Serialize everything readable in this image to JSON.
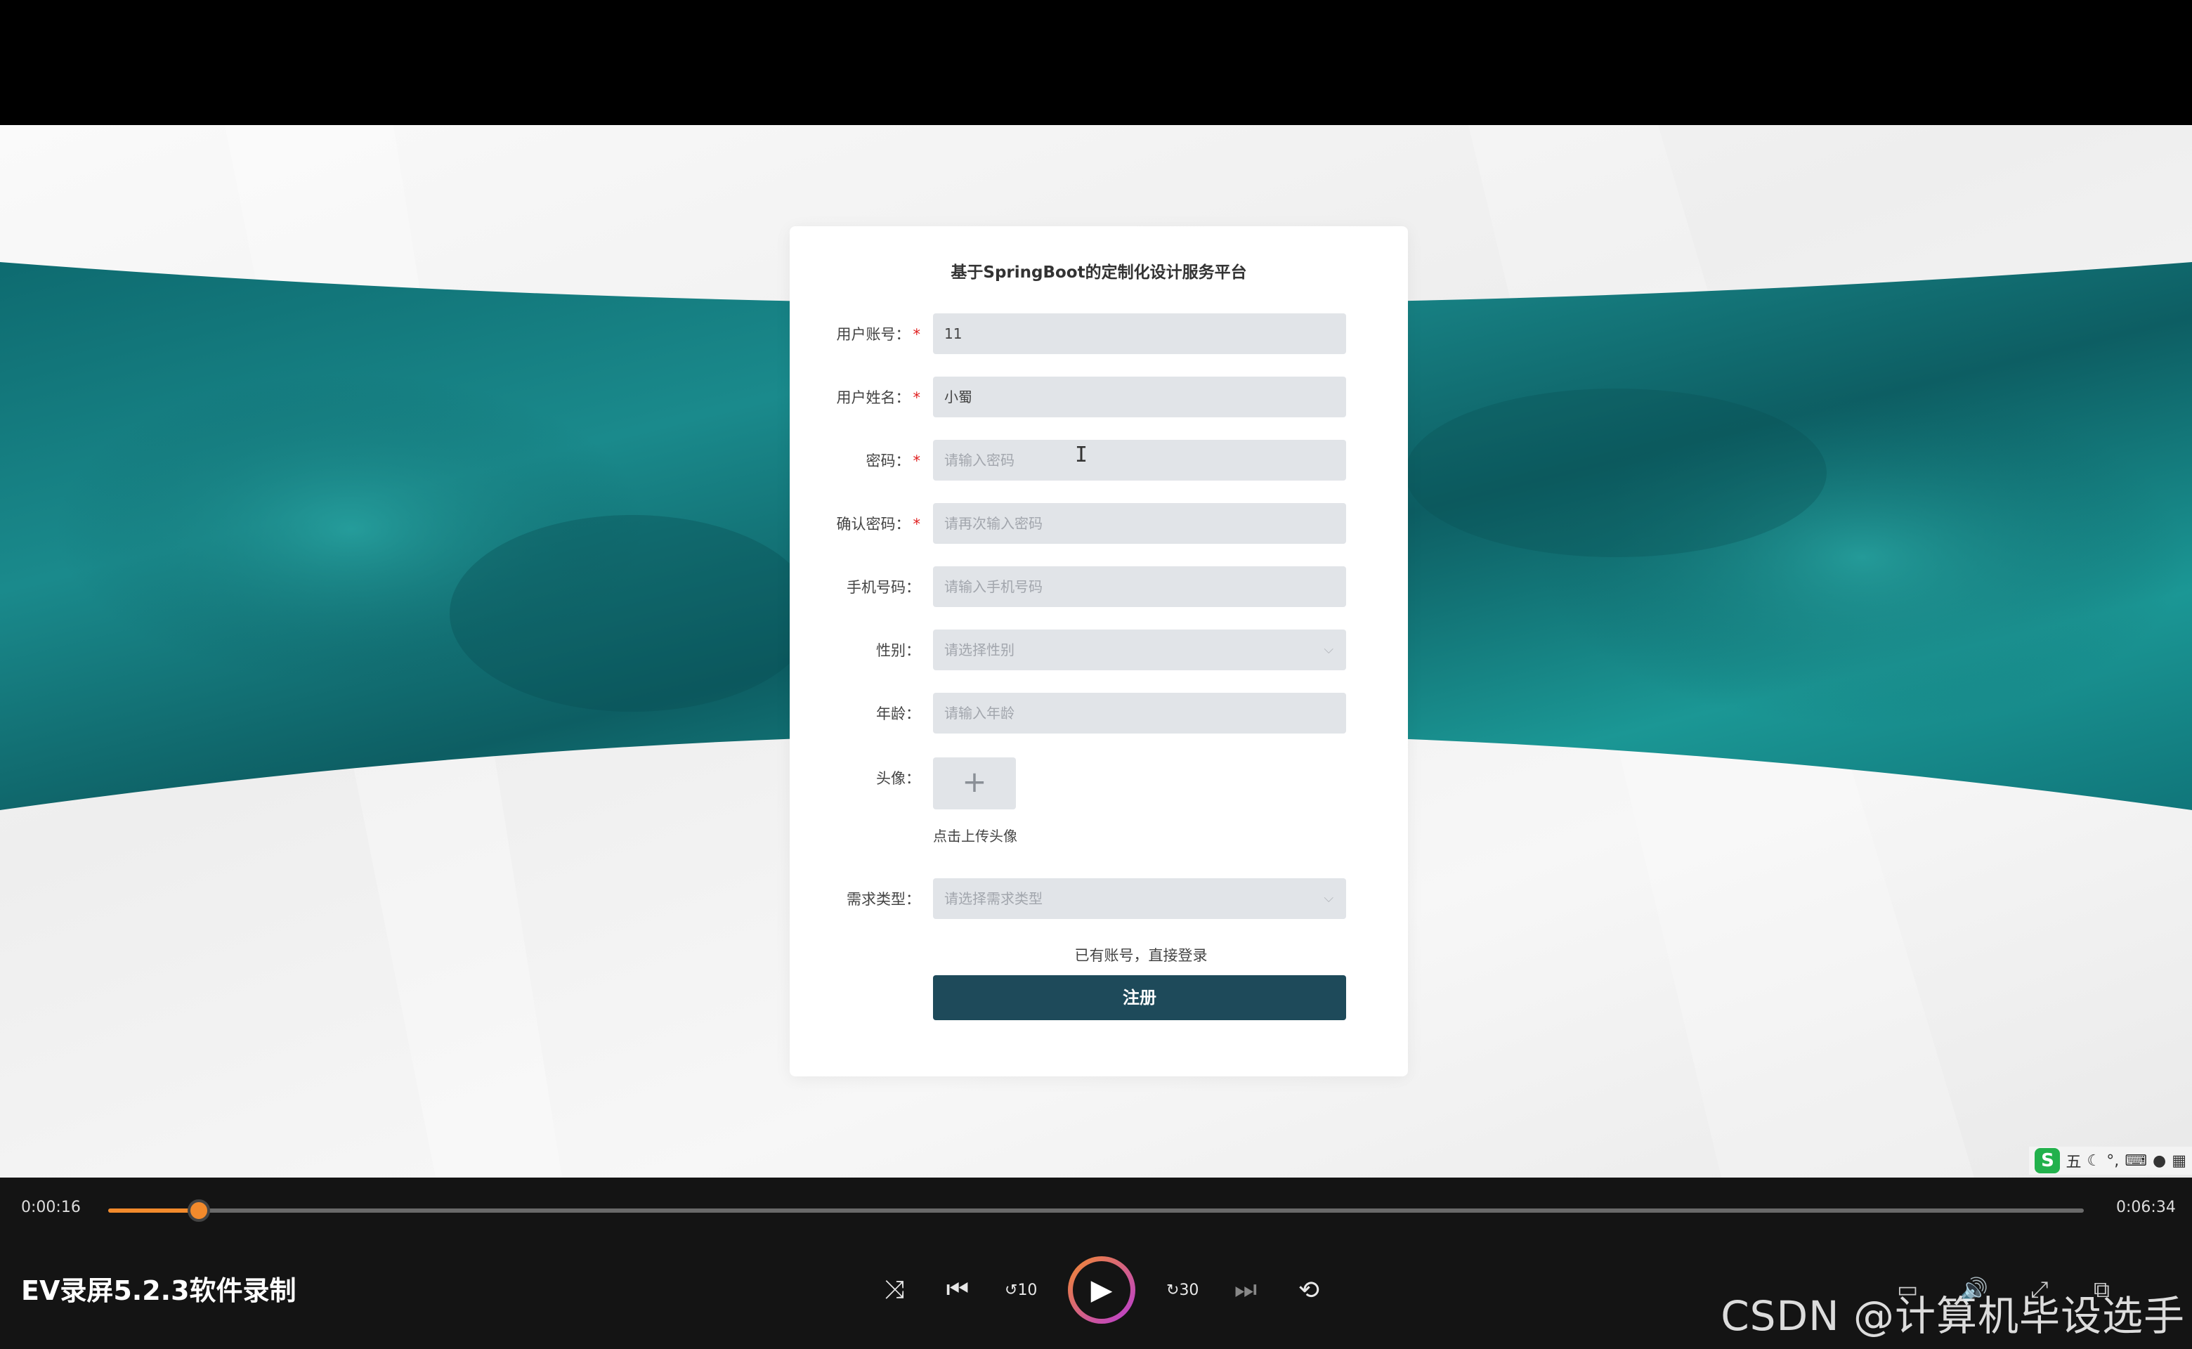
{
  "form": {
    "title": "基于SpringBoot的定制化设计服务平台",
    "fields": [
      {
        "label": "用户账号",
        "required": true,
        "value": "11",
        "placeholder": ""
      },
      {
        "label": "用户姓名",
        "required": true,
        "value": "小蜀",
        "placeholder": ""
      },
      {
        "label": "密码",
        "required": true,
        "value": "",
        "placeholder": "请输入密码"
      },
      {
        "label": "确认密码",
        "required": true,
        "value": "",
        "placeholder": "请再次输入密码"
      },
      {
        "label": "手机号码",
        "required": false,
        "value": "",
        "placeholder": "请输入手机号码"
      },
      {
        "label": "性别",
        "required": false,
        "value": "",
        "placeholder": "请选择性别",
        "type": "select"
      },
      {
        "label": "年龄",
        "required": false,
        "value": "",
        "placeholder": "请输入年龄"
      }
    ],
    "avatar": {
      "label": "头像",
      "upload_icon": "plus-icon",
      "hint": "点击上传头像"
    },
    "demand_type": {
      "label": "需求类型",
      "placeholder": "请选择需求类型"
    },
    "login_link": "已有账号，直接登录",
    "submit_label": "注册",
    "colon": "：",
    "required_mark": "*"
  },
  "player": {
    "current_time": "0:00:16",
    "total_time": "0:06:34",
    "progress": 0.046,
    "title": "EV录屏5.2.3软件录制",
    "controls": [
      "shuffle-icon",
      "previous-icon",
      "rewind-10-icon",
      "play-icon",
      "forward-30-icon",
      "next-icon",
      "repeat-icon"
    ],
    "rewind_label": "10",
    "forward_label": "30",
    "right_controls": [
      "subtitle-icon",
      "volume-icon",
      "fullscreen-icon",
      "pip-icon"
    ]
  },
  "ime": {
    "logo": "S",
    "mode": "五",
    "items": [
      "moon-icon",
      "punct-icon",
      "keyboard-icon",
      "user-icon",
      "grid-icon"
    ]
  },
  "watermark": "CSDN @计算机毕设选手",
  "colors": {
    "accent": "#f28a2c",
    "button": "#1e4a5a",
    "teal": "#137a7e",
    "required": "#e02020"
  }
}
